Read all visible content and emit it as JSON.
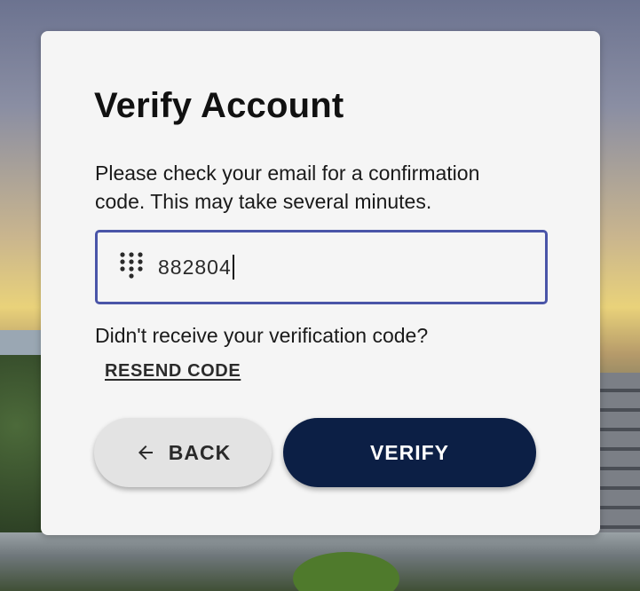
{
  "card": {
    "title": "Verify Account",
    "description": "Please check your email for a confirmation code. This may take several minutes."
  },
  "code_field": {
    "icon": "dialpad-icon",
    "value": "882804"
  },
  "resend": {
    "prompt": "Didn't receive your verification code?",
    "link_label": "RESEND CODE"
  },
  "actions": {
    "back_label": "BACK",
    "back_icon": "arrow-left-icon",
    "verify_label": "VERIFY"
  },
  "colors": {
    "field_border": "#4a55a8",
    "verify_button": "#0c1f45",
    "back_button": "#e3e3e3",
    "card_background": "#f5f5f5"
  }
}
